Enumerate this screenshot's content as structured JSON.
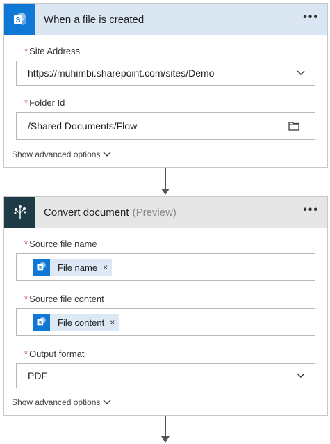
{
  "trigger": {
    "title": "When a file is created",
    "menu": "•••",
    "site_label": "Site Address",
    "site_value": "https://muhimbi.sharepoint.com/sites/Demo",
    "folder_label": "Folder Id",
    "folder_value": "/Shared Documents/Flow",
    "advanced": "Show advanced options"
  },
  "action": {
    "title": "Convert document",
    "subtitle": "(Preview)",
    "menu": "•••",
    "source_name_label": "Source file name",
    "source_name_token": "File name",
    "source_content_label": "Source file content",
    "source_content_token": "File content",
    "output_label": "Output format",
    "output_value": "PDF",
    "advanced": "Show advanced options",
    "remove": "×"
  },
  "colors": {
    "sharepoint": "#0f78d4",
    "muhimbi": "#1d3b47",
    "required": "#d9534f"
  }
}
